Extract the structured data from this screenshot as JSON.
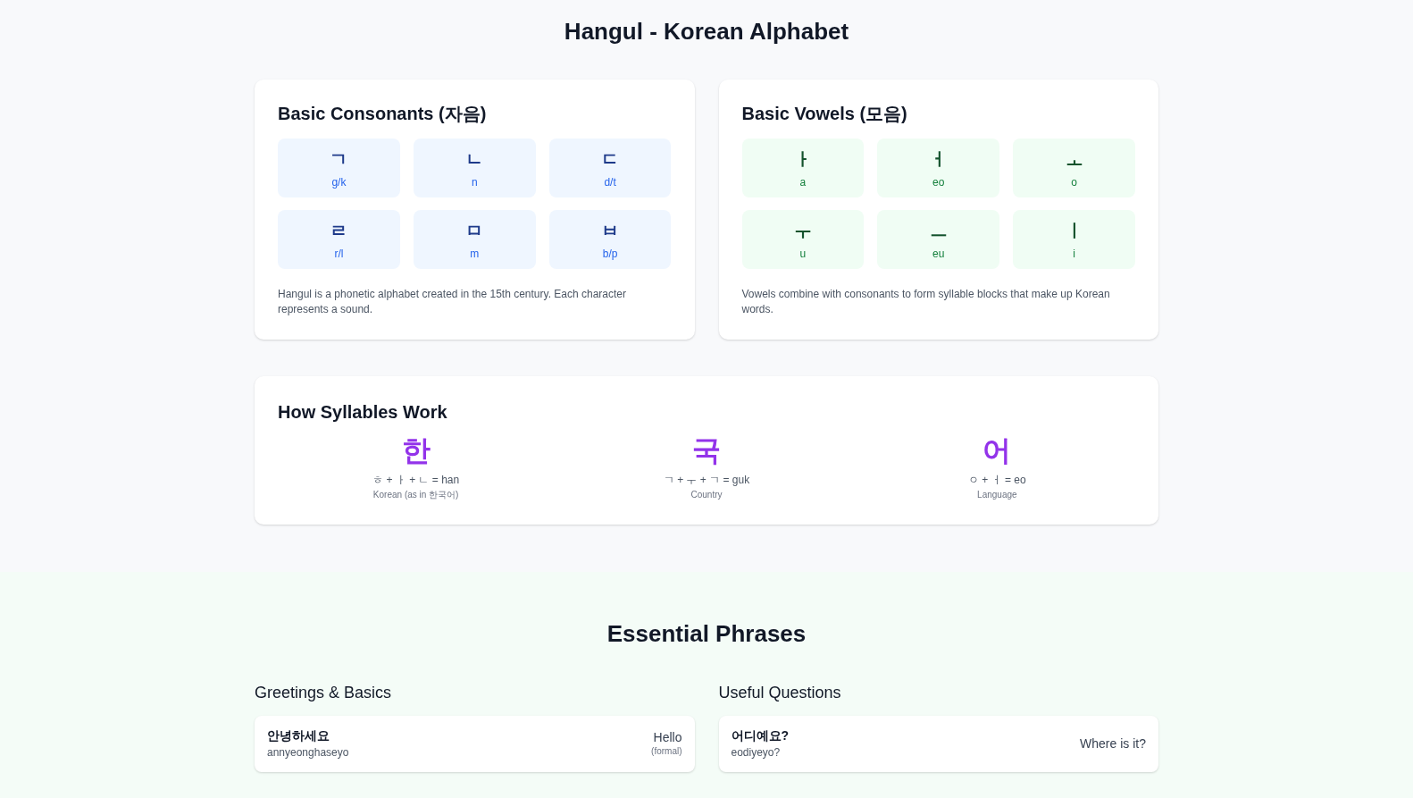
{
  "page_title": "Hangul - Korean Alphabet",
  "alphabet_cards": [
    {
      "kind": "consonant",
      "title": "Basic Consonants (자음)",
      "letters": [
        {
          "glyph": "ㄱ",
          "sound": "g/k"
        },
        {
          "glyph": "ㄴ",
          "sound": "n"
        },
        {
          "glyph": "ㄷ",
          "sound": "d/t"
        },
        {
          "glyph": "ㄹ",
          "sound": "r/l"
        },
        {
          "glyph": "ㅁ",
          "sound": "m"
        },
        {
          "glyph": "ㅂ",
          "sound": "b/p"
        }
      ],
      "description": "Hangul is a phonetic alphabet created in the 15th century. Each character represents a sound."
    },
    {
      "kind": "vowel",
      "title": "Basic Vowels (모음)",
      "letters": [
        {
          "glyph": "ㅏ",
          "sound": "a"
        },
        {
          "glyph": "ㅓ",
          "sound": "eo"
        },
        {
          "glyph": "ㅗ",
          "sound": "o"
        },
        {
          "glyph": "ㅜ",
          "sound": "u"
        },
        {
          "glyph": "ㅡ",
          "sound": "eu"
        },
        {
          "glyph": "ㅣ",
          "sound": "i"
        }
      ],
      "description": "Vowels combine with consonants to form syllable blocks that make up Korean words."
    }
  ],
  "syllables": {
    "title": "How Syllables Work",
    "items": [
      {
        "syllable": "한",
        "formula": "ㅎ + ㅏ + ㄴ = han",
        "meaning": "Korean (as in 한국어)"
      },
      {
        "syllable": "국",
        "formula": "ㄱ + ㅜ + ㄱ = guk",
        "meaning": "Country"
      },
      {
        "syllable": "어",
        "formula": "ㅇ + ㅓ = eo",
        "meaning": "Language"
      }
    ]
  },
  "phrases": {
    "title": "Essential Phrases",
    "groups": [
      {
        "title": "Greetings & Basics",
        "items": [
          {
            "korean": "안녕하세요",
            "romanization": "annyeonghaseyo",
            "english": "Hello",
            "note": "(formal)"
          }
        ]
      },
      {
        "title": "Useful Questions",
        "items": [
          {
            "korean": "어디예요?",
            "romanization": "eodiyeyo?",
            "english": "Where is it?"
          }
        ]
      }
    ]
  }
}
